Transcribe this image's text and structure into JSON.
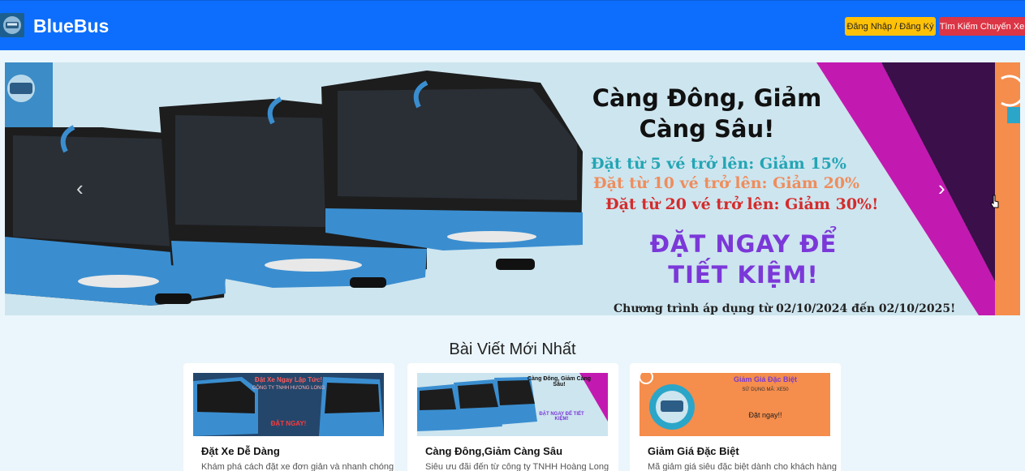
{
  "header": {
    "brand": "BlueBus",
    "login_button": "Đăng Nhập / Đăng Ký",
    "search_button": "Tìm Kiếm Chuyến Xe"
  },
  "banner": {
    "title_line1": "Càng Đông, Giảm",
    "title_line2": "Càng Sâu!",
    "offer_1": "Đặt từ 5 vé trở lên: Giảm 15%",
    "offer_2": "Đặt từ 10 vé trở lên: Giảm 20%",
    "offer_3": "Đặt từ 20 vé trở lên: Giảm 30%!",
    "cta_line1": "ĐẶT NGAY ĐỂ",
    "cta_line2": "TIẾT KIỆM!",
    "validity": "Chương trình áp dụng từ 02/10/2024 đến 02/10/2025!"
  },
  "articles": {
    "section_title": "Bài Viết Mới Nhất",
    "items": [
      {
        "title": "Đặt Xe Dễ Dàng",
        "desc": "Khám phá cách đặt xe đơn giản và nhanh chóng",
        "img_headline": "Đặt Xe Ngay Lập Tức!",
        "img_sub": "CÔNG TY TNHH HƯƠNG LONG",
        "img_button": "ĐẶT NGAY!"
      },
      {
        "title": "Càng Đông,Giảm Càng Sâu",
        "desc": "Siêu ưu đãi đến từ công ty TNHH Hoàng Long",
        "img_headline": "Càng Đông, Giảm Càng Sâu!",
        "img_button": "ĐẶT NGAY ĐỂ TIẾT KIỆM!"
      },
      {
        "title": "Giảm Giá Đặc Biệt",
        "desc": "Mã giảm giá siêu đặc biệt dành cho khách hàng",
        "img_headline": "Giảm Giá Đặc Biệt",
        "img_code": "SỬ DỤNG MÃ: XE50",
        "img_button": "Đặt ngay!!"
      }
    ]
  },
  "colors": {
    "navbar": "#0d6efd",
    "login_button": "#ffc107",
    "search_button": "#dc3545",
    "page_background": "#eaf6fb",
    "bus_blue": "#3d8fd0"
  }
}
